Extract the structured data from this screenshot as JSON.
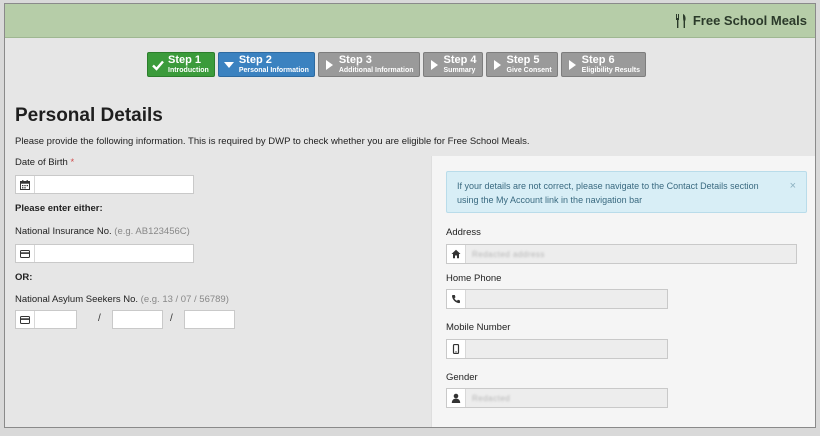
{
  "header": {
    "title": "Free School Meals",
    "icon": "fork-knife-icon"
  },
  "steps": [
    {
      "number": "Step 1",
      "label": "Introduction",
      "state": "done"
    },
    {
      "number": "Step 2",
      "label": "Personal Information",
      "state": "current"
    },
    {
      "number": "Step 3",
      "label": "Additional Information",
      "state": "pending"
    },
    {
      "number": "Step 4",
      "label": "Summary",
      "state": "pending"
    },
    {
      "number": "Step 5",
      "label": "Give Consent",
      "state": "pending"
    },
    {
      "number": "Step 6",
      "label": "Eligibility Results",
      "state": "pending"
    }
  ],
  "page": {
    "title": "Personal Details",
    "intro": "Please provide the following information. This is required by DWP to check whether you are eligible for Free School Meals."
  },
  "form": {
    "dob_label": "Date of Birth",
    "required_mark": "*",
    "either_label": "Please enter either:",
    "ni_label": "National Insurance No.",
    "ni_hint": "(e.g. AB123456C)",
    "or_label": "OR:",
    "nass_label": "National Asylum Seekers No.",
    "nass_hint": "(e.g. 13 / 07 / 56789)",
    "separator": "/"
  },
  "contact": {
    "alert": "If your details are not correct, please navigate to the Contact Details section using the My Account link in the navigation bar",
    "close": "×",
    "address_label": "Address",
    "address_value": "Redacted address",
    "home_phone_label": "Home Phone",
    "mobile_label": "Mobile Number",
    "gender_label": "Gender",
    "gender_value": "Redacted"
  },
  "colors": {
    "topbar": "#b6cda8",
    "done": "#3b9b3b",
    "current": "#3b82c0",
    "pending": "#9a9a9a",
    "alert_bg": "#d8eef6",
    "required": "#d04a4a"
  }
}
